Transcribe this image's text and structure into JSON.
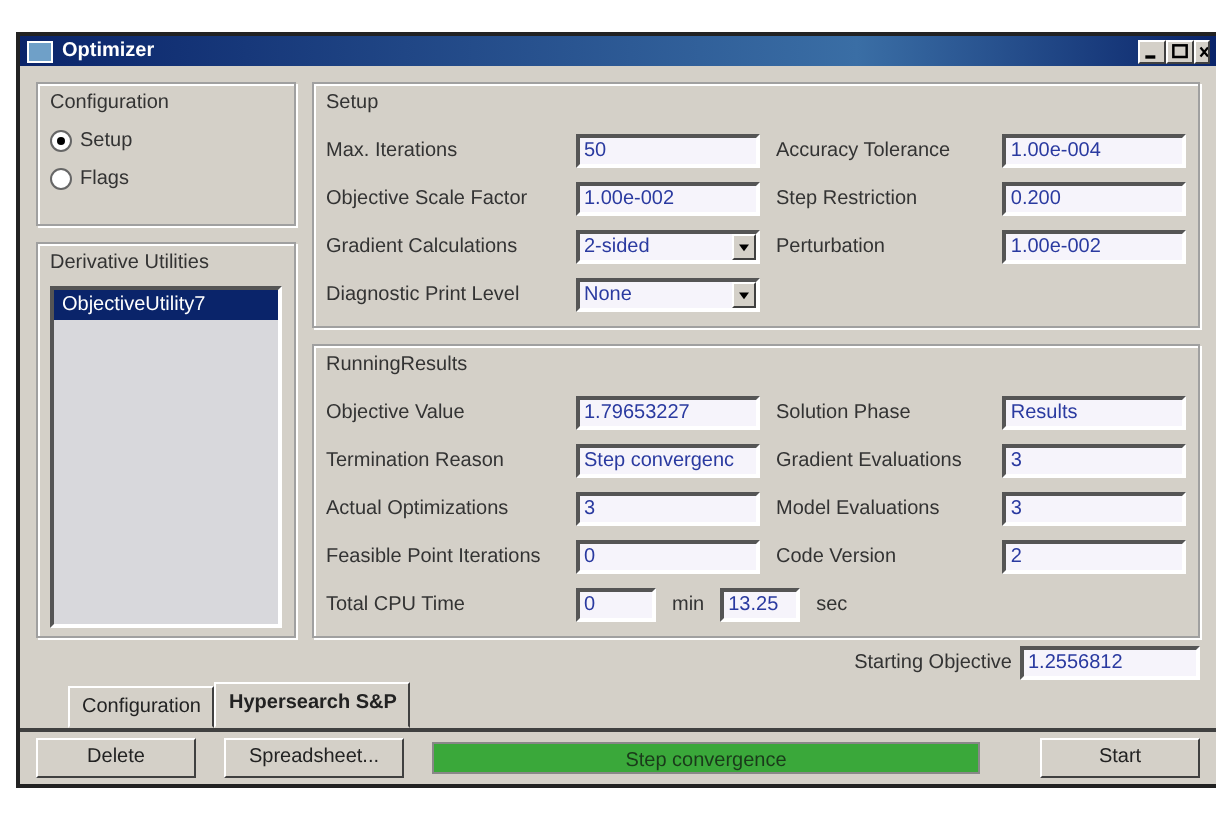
{
  "window": {
    "title": "Optimizer"
  },
  "configuration": {
    "title": "Configuration",
    "options": [
      {
        "label": "Setup",
        "selected": true
      },
      {
        "label": "Flags",
        "selected": false
      }
    ]
  },
  "derivative_utilities": {
    "title": "Derivative Utilities",
    "items": [
      {
        "label": "ObjectiveUtility7",
        "selected": true
      }
    ]
  },
  "setup": {
    "title": "Setup",
    "columns": [
      [
        {
          "label": "Max. Iterations",
          "value": "50",
          "kind": "text"
        },
        {
          "label": "Objective Scale Factor",
          "value": "1.00e-002",
          "kind": "text"
        },
        {
          "label": "Gradient Calculations",
          "value": "2-sided",
          "kind": "combo"
        },
        {
          "label": "Diagnostic Print Level",
          "value": "None",
          "kind": "combo"
        }
      ],
      [
        {
          "label": "Accuracy Tolerance",
          "value": "1.00e-004",
          "kind": "text"
        },
        {
          "label": "Step Restriction",
          "value": "0.200",
          "kind": "text"
        },
        {
          "label": "Perturbation",
          "value": "1.00e-002",
          "kind": "text"
        }
      ]
    ]
  },
  "running_results": {
    "title": "RunningResults",
    "columns": [
      [
        {
          "label": "Objective Value",
          "value": "1.79653227"
        },
        {
          "label": "Termination Reason",
          "value": "Step convergenc"
        },
        {
          "label": "Actual Optimizations",
          "value": "3"
        },
        {
          "label": "Feasible Point Iterations",
          "value": "0"
        }
      ],
      [
        {
          "label": "Solution Phase",
          "value": "Results"
        },
        {
          "label": "Gradient Evaluations",
          "value": "3"
        },
        {
          "label": "Model Evaluations",
          "value": "3"
        },
        {
          "label": "Code Version",
          "value": "2"
        }
      ]
    ],
    "cpu_time": {
      "label": "Total CPU Time",
      "minutes": "0",
      "min_unit": "min",
      "seconds": "13.25",
      "sec_unit": "sec"
    }
  },
  "starting_objective": {
    "label": "Starting Objective",
    "value": "1.2556812"
  },
  "tabs": [
    {
      "label": "Configuration",
      "selected": false
    },
    {
      "label": "Hypersearch S&P",
      "selected": true
    }
  ],
  "buttons": {
    "delete": "Delete",
    "spreadsheet": "Spreadsheet...",
    "start": "Start"
  },
  "progress": {
    "text": "Step convergence",
    "level": 1
  }
}
